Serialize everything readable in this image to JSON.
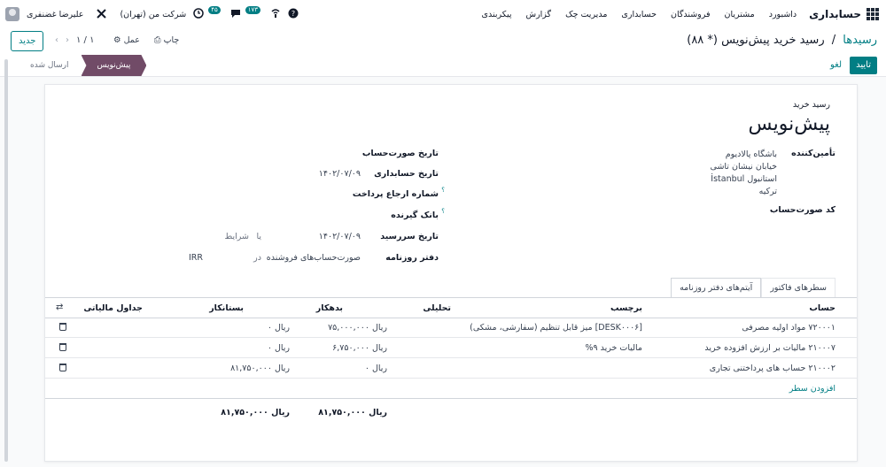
{
  "nav": {
    "app_title": "حسابداری",
    "menu": [
      "داشبورد",
      "مشتریان",
      "فروشندگان",
      "حسابداری",
      "مدیریت چک",
      "گزارش",
      "پیکربندی"
    ],
    "user_name": "علیرضا غضنفری",
    "company": "شرکت من (تهران)",
    "activity_badge": "۴۵",
    "message_badge": "۱۷۳"
  },
  "control": {
    "breadcrumb_root": "رسیدها",
    "breadcrumb_sep": "/",
    "breadcrumb_current": "رسید خرید پیش‌نویس (* ۸۸)",
    "new_button": "جدید",
    "pager": "۱ / ۱",
    "print": "چاپ",
    "action": "عمل"
  },
  "statusbar": {
    "confirm": "تایید",
    "cancel": "لغو",
    "states": [
      "پیش‌نویس",
      "ارسال شده"
    ]
  },
  "form": {
    "doc_type": "رسید خرید",
    "doc_title": "پیش‌نویس",
    "vendor_label": "تأمین‌کننده",
    "vendor_lines": [
      "باشگاه پالادیوم",
      "خیابان نیشان تاشی",
      "استانبول İstanbul",
      "ترکیه"
    ],
    "billing_ref_label": "کد صورت‌حساب",
    "invoice_date_label": "تاریخ صورت‌حساب",
    "accounting_date_label": "تاریخ حسابداری",
    "accounting_date": "۱۴۰۲/۰۷/۰۹",
    "payment_ref_label": "شماره ارجاع پرداخت",
    "bank_label": "بانک گیرنده",
    "due_date_label": "تاریخ سررسید",
    "due_date": "۱۴۰۲/۰۷/۰۹",
    "or": "یا",
    "terms": "شرایط",
    "journal_label": "دفتر روزنامه",
    "journal": "صورت‌حساب‌های فروشنده",
    "in": "در",
    "currency": "IRR"
  },
  "tabs": [
    "سطرهای فاکتور",
    "آیتم‌های دفتر روزنامه"
  ],
  "table": {
    "headers": [
      "حساب",
      "برچسب",
      "تحلیلی",
      "بدهکار",
      "بستانکار",
      "جداول مالیاتی"
    ],
    "rows": [
      {
        "account": "۷۲۰۰۰۱ مواد اولیه مصرفی",
        "label": "[DESK۰۰۰۶] میز قابل تنظیم (سفارشی، مشکی)",
        "debit": "ریال ۷۵,۰۰۰,۰۰۰",
        "credit": "ریال ۰"
      },
      {
        "account": "۲۱۰۰۰۷ مالیات بر ارزش افزوده خرید",
        "label": "مالیات خرید ۹%",
        "debit": "ریال ۶,۷۵۰,۰۰۰",
        "credit": "ریال ۰"
      },
      {
        "account": "۲۱۰۰۰۲ حساب های پرداختنی تجاری",
        "label": "",
        "debit": "ریال ۰",
        "credit": "ریال ۸۱,۷۵۰,۰۰۰"
      }
    ],
    "add_line": "افزودن سطر",
    "total_debit": "ریال ۸۱,۷۵۰,۰۰۰",
    "total_credit": "ریال ۸۱,۷۵۰,۰۰۰"
  }
}
